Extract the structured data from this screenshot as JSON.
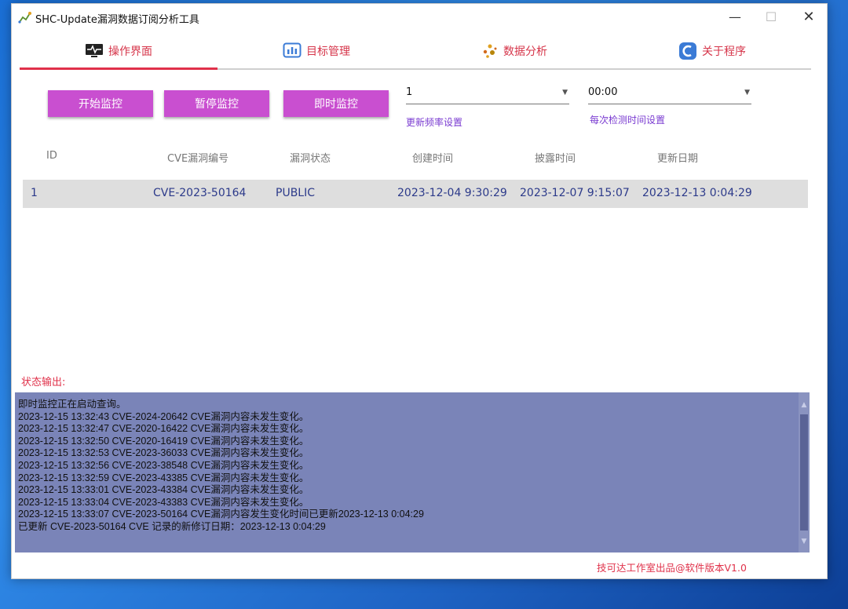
{
  "window": {
    "title": "SHC-Update漏洞数据订阅分析工具"
  },
  "tabs": [
    {
      "label": "操作界面",
      "icon": "monitor-pulse-icon"
    },
    {
      "label": "目标管理",
      "icon": "bar-chart-icon"
    },
    {
      "label": "数据分析",
      "icon": "scatter-dots-icon"
    },
    {
      "label": "关于程序",
      "icon": "app-logo-icon"
    }
  ],
  "buttons": {
    "start": "开始监控",
    "pause": "暂停监控",
    "instant": "即时监控"
  },
  "frequency": {
    "value": "1",
    "hint": "更新频率设置"
  },
  "check_time": {
    "value": "00:00",
    "hint": "每次检测时间设置"
  },
  "table": {
    "headers": [
      "ID",
      "CVE漏洞编号",
      "漏洞状态",
      "创建时间",
      "披露时间",
      "更新日期"
    ],
    "rows": [
      [
        "1",
        "CVE-2023-50164",
        "PUBLIC",
        "2023-12-04 9:30:29",
        "2023-12-07 9:15:07",
        "2023-12-13 0:04:29"
      ]
    ]
  },
  "status": {
    "label": "状态输出:",
    "lines": [
      "即时监控正在启动查询。",
      "2023-12-15 13:32:43  CVE-2024-20642 CVE漏洞内容未发生变化。",
      "2023-12-15 13:32:47  CVE-2020-16422 CVE漏洞内容未发生变化。",
      "2023-12-15 13:32:50  CVE-2020-16419 CVE漏洞内容未发生变化。",
      "2023-12-15 13:32:53  CVE-2023-36033 CVE漏洞内容未发生变化。",
      "2023-12-15 13:32:56  CVE-2023-38548 CVE漏洞内容未发生变化。",
      "2023-12-15 13:32:59  CVE-2023-43385 CVE漏洞内容未发生变化。",
      "2023-12-15 13:33:01  CVE-2023-43384 CVE漏洞内容未发生变化。",
      "2023-12-15 13:33:04  CVE-2023-43383 CVE漏洞内容未发生变化。",
      "2023-12-15 13:33:07  CVE-2023-50164 CVE漏洞内容发生变化时间已更新2023-12-13 0:04:29",
      "已更新 CVE-2023-50164 CVE 记录的新修订日期：2023-12-13 0:04:29"
    ]
  },
  "footer": "技可达工作室出品@软件版本V1.0",
  "colors": {
    "accent": "#e0314a",
    "button": "#c94fd0",
    "console_bg": "#7a84b8",
    "hint": "#7a3bd1"
  }
}
